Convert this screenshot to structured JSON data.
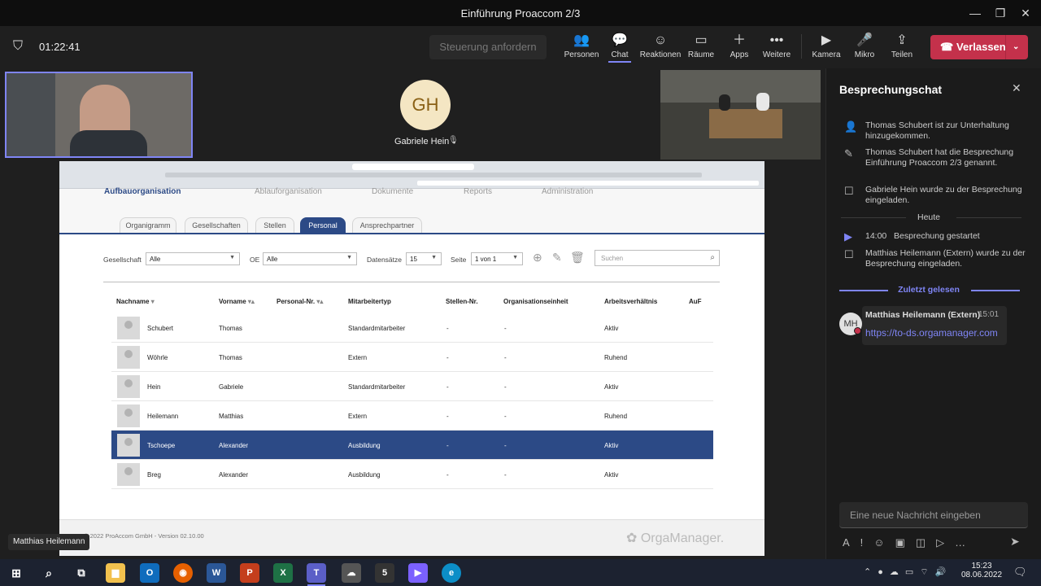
{
  "window": {
    "title": "Einführung Proaccom 2/3"
  },
  "meeting": {
    "timer": "01:22:41",
    "control_request": "Steuerung anfordern",
    "leave": "Verlassen"
  },
  "toolbar": {
    "items": [
      "Personen",
      "Chat",
      "Reaktionen",
      "Räume",
      "Apps",
      "Weitere",
      "Kamera",
      "Mikro",
      "Teilen"
    ]
  },
  "participants": {
    "gh_initials": "GH",
    "gh_name": "Gabriele Hein",
    "self_name": "Matthias Heilemann"
  },
  "app": {
    "nav": [
      "Aufbauorganisation",
      "Ablauforganisation",
      "Dokumente",
      "Reports",
      "Administration"
    ],
    "tabs": [
      "Organigramm",
      "Gesellschaften",
      "Stellen",
      "Personal",
      "Ansprechpartner"
    ],
    "filters": {
      "gesellschaft_label": "Gesellschaft",
      "gesellschaft_value": "Alle",
      "oe_label": "OE",
      "oe_value": "Alle",
      "datensaetze_label": "Datensätze",
      "datensaetze_value": "15",
      "seite_label": "Seite",
      "seite_value": "1 von 1",
      "search_placeholder": "Suchen"
    },
    "columns": [
      "Nachname",
      "Vorname",
      "Personal-Nr.",
      "Mitarbeitertyp",
      "Stellen-Nr.",
      "Organisationseinheit",
      "Arbeitsverhältnis",
      "AuF"
    ],
    "rows": [
      {
        "nachname": "Schubert",
        "vorname": "Thomas",
        "typ": "Standardmitarbeiter",
        "stelle": "-",
        "oe": "-",
        "status": "Aktiv"
      },
      {
        "nachname": "Wöhrle",
        "vorname": "Thomas",
        "typ": "Extern",
        "stelle": "-",
        "oe": "-",
        "status": "Ruhend"
      },
      {
        "nachname": "Hein",
        "vorname": "Gabriele",
        "typ": "Standardmitarbeiter",
        "stelle": "-",
        "oe": "-",
        "status": "Aktiv"
      },
      {
        "nachname": "Heilemann",
        "vorname": "Matthias",
        "typ": "Extern",
        "stelle": "-",
        "oe": "-",
        "status": "Ruhend"
      },
      {
        "nachname": "Tschoepe",
        "vorname": "Alexander",
        "typ": "Ausbildung",
        "stelle": "-",
        "oe": "-",
        "status": "Aktiv"
      },
      {
        "nachname": "Breg",
        "vorname": "Alexander",
        "typ": "Ausbildung",
        "stelle": "-",
        "oe": "-",
        "status": "Aktiv"
      }
    ],
    "footer": "© 2022 ProAccom GmbH - Version 02.10.00",
    "logo": "OrgaManager."
  },
  "chat": {
    "title": "Besprechungschat",
    "events": [
      "Thomas Schubert ist zur Unterhaltung hinzugekommen.",
      "Thomas Schubert hat die Besprechung Einführung Proaccom 2/3 genannt.",
      "Gabriele Hein wurde zu der Besprechung eingeladen."
    ],
    "today": "Heute",
    "started_time": "14:00",
    "started_text": "Besprechung gestartet",
    "invite2": "Matthias Heilemann (Extern) wurde zu der Besprechung eingeladen.",
    "last_read": "Zuletzt gelesen",
    "msg": {
      "initials": "MH",
      "author": "Matthias Heilemann (Extern)",
      "time": "15:01",
      "link": "https://to-ds.orgamanager.com"
    },
    "input_placeholder": "Eine neue Nachricht eingeben"
  },
  "taskbar": {
    "time": "15:23",
    "date": "08.06.2022"
  }
}
